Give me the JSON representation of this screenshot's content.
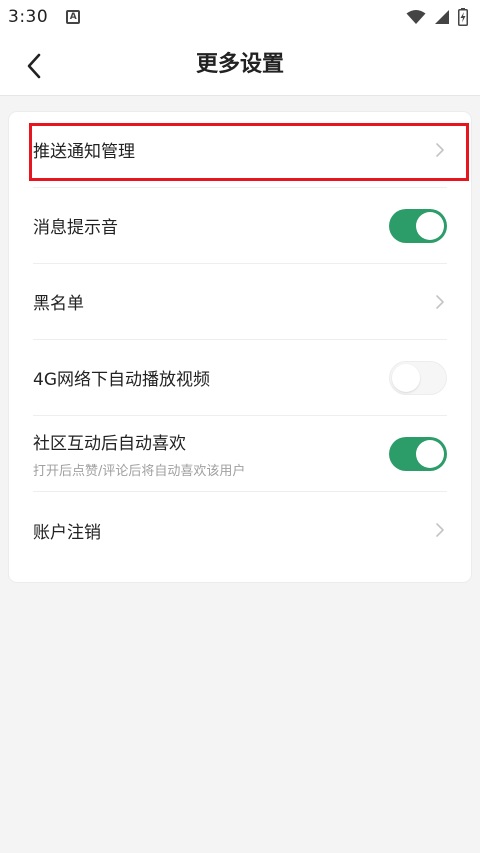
{
  "status_bar": {
    "time": "3:30",
    "notification_icon": "a-square-icon",
    "right_icons": [
      "wifi-icon",
      "signal-icon",
      "battery-charging-icon"
    ]
  },
  "header": {
    "title": "更多设置",
    "back_icon": "chevron-left-icon"
  },
  "settings": [
    {
      "label": "推送通知管理",
      "control": "chevron",
      "highlighted": true
    },
    {
      "label": "消息提示音",
      "control": "toggle",
      "on": true
    },
    {
      "label": "黑名单",
      "control": "chevron"
    },
    {
      "label": "4G网络下自动播放视频",
      "control": "toggle",
      "on": false
    },
    {
      "label": "社区互动后自动喜欢",
      "sublabel": "打开后点赞/评论后将自动喜欢该用户",
      "control": "toggle",
      "on": true
    },
    {
      "label": "账户注销",
      "control": "chevron"
    }
  ],
  "colors": {
    "toggle_on": "#2c9c69",
    "highlight": "#e8141e",
    "background": "#f4f4f4"
  }
}
